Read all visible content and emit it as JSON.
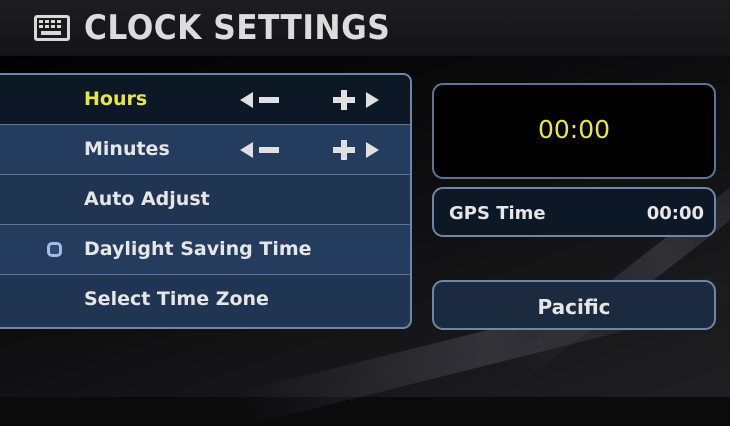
{
  "header": {
    "title": "CLOCK SETTINGS",
    "icon": "keyboard-icon"
  },
  "menu": {
    "items": [
      {
        "label": "Hours",
        "selected": true,
        "controls": [
          "decrease-arrow-icon",
          "increase-arrow-icon"
        ]
      },
      {
        "label": "Minutes",
        "controls": [
          "decrease-arrow-icon",
          "increase-arrow-icon"
        ]
      },
      {
        "label": "Auto Adjust"
      },
      {
        "label": "Daylight Saving Time",
        "checkbox": true,
        "checked": false
      },
      {
        "label": "Select Time Zone"
      }
    ]
  },
  "clock": {
    "time": "00:00"
  },
  "gps": {
    "label": "GPS Time",
    "value": "00:00"
  },
  "timezone": {
    "value": "Pacific"
  },
  "colors": {
    "highlight_text": "#e9e64a",
    "menu_bg": "#1f3552",
    "selected_bg": "#0d1827",
    "border": "#6f86a8",
    "text": "#e6e6e6"
  }
}
